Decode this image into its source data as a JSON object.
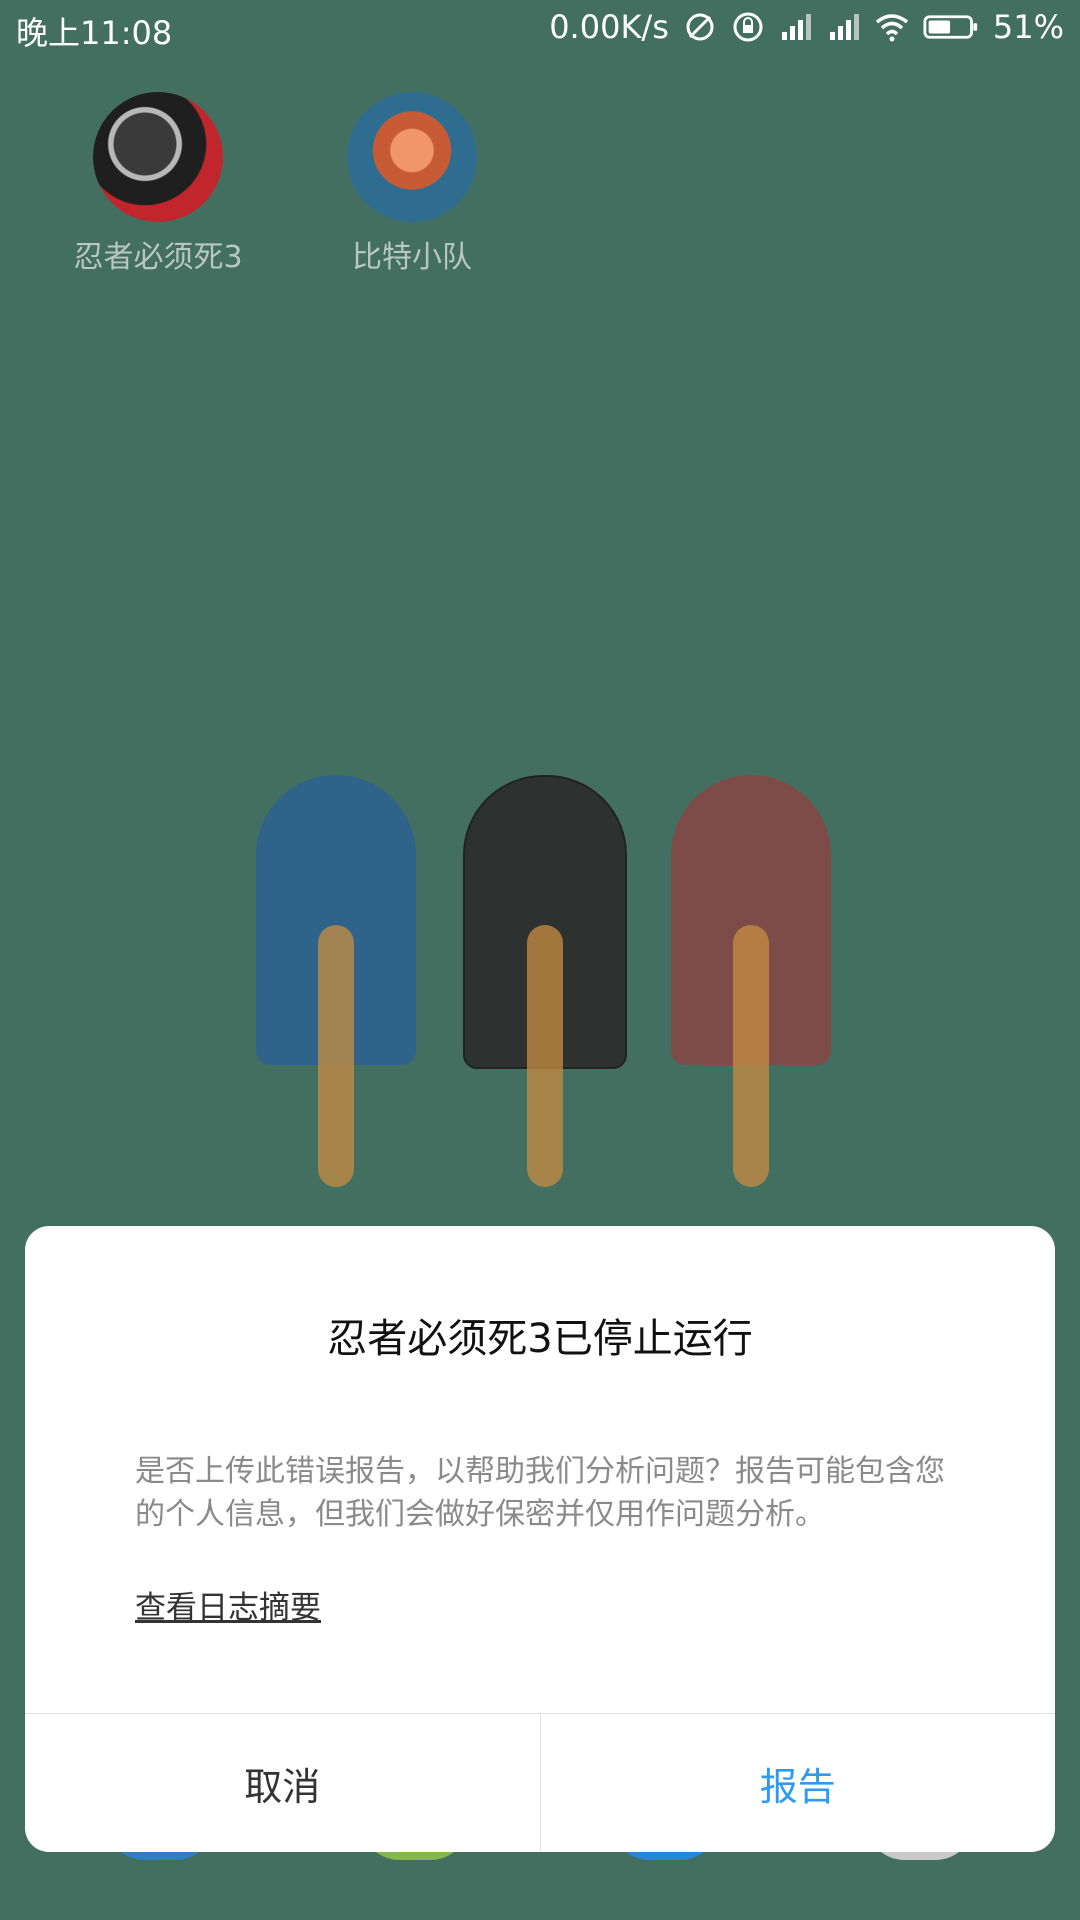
{
  "status_bar": {
    "time": "晚上11:08",
    "net_speed": "0.00K/s",
    "battery": "51%",
    "icons": [
      "sync-off-icon",
      "rotation-lock-icon",
      "signal-icon",
      "signal-icon",
      "wifi-icon",
      "battery-icon"
    ]
  },
  "home": {
    "apps": [
      {
        "label": "忍者必须死3",
        "icon": "ninja-game-icon"
      },
      {
        "label": "比特小队",
        "icon": "bit-squad-game-icon"
      }
    ],
    "popsicle_colors": [
      "#3d6b93",
      "#2d3130",
      "#7e5147"
    ]
  },
  "dialog": {
    "title": "忍者必须死3已停止运行",
    "message": "是否上传此错误报告，以帮助我们分析问题？报告可能包含您的个人信息，但我们会做好保密并仅用作问题分析。",
    "link": "查看日志摘要",
    "cancel_label": "取消",
    "report_label": "报告",
    "accent_color": "#2e9bf0"
  }
}
